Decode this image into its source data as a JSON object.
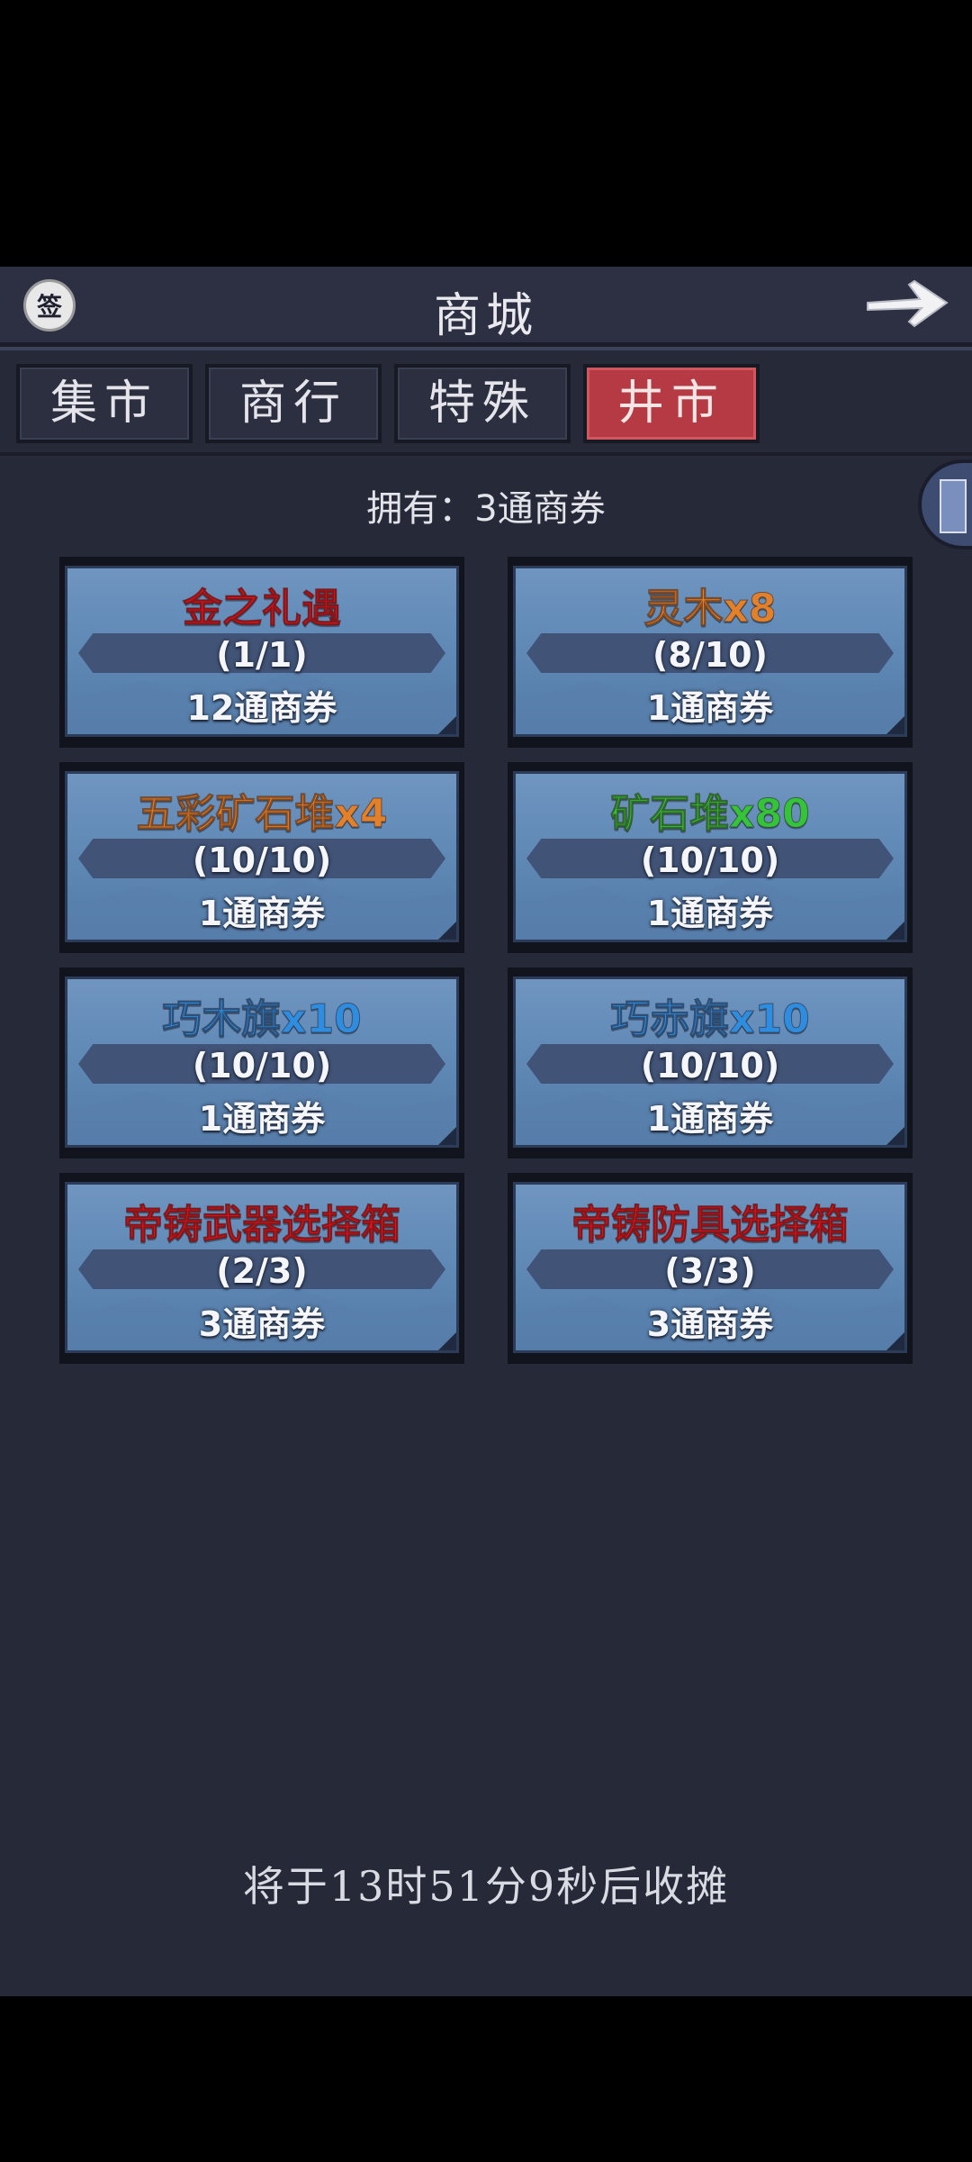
{
  "header": {
    "title": "商城",
    "seal_text": "签"
  },
  "tabs": [
    {
      "label": "集市",
      "active": false
    },
    {
      "label": "商行",
      "active": false
    },
    {
      "label": "特殊",
      "active": false
    },
    {
      "label": "井市",
      "active": true
    }
  ],
  "owned": "拥有：3通商券",
  "items": [
    {
      "name": "金之礼遇",
      "qty": "(1/1)",
      "price": "12通商券",
      "color": "#e8141b"
    },
    {
      "name": "灵木x8",
      "qty": "(8/10)",
      "price": "1通商券",
      "color": "#e3812a"
    },
    {
      "name": "五彩矿石堆x4",
      "qty": "(10/10)",
      "price": "1通商券",
      "color": "#e3812a"
    },
    {
      "name": "矿石堆x80",
      "qty": "(10/10)",
      "price": "1通商券",
      "color": "#35c33a"
    },
    {
      "name": "巧木旗x10",
      "qty": "(10/10)",
      "price": "1通商券",
      "color": "#2f8de0"
    },
    {
      "name": "巧赤旗x10",
      "qty": "(10/10)",
      "price": "1通商券",
      "color": "#2f8de0"
    },
    {
      "name": "帝铸武器选择箱",
      "qty": "(2/3)",
      "price": "3通商券",
      "color": "#e8141b"
    },
    {
      "name": "帝铸防具选择箱",
      "qty": "(3/3)",
      "price": "3通商券",
      "color": "#e8141b"
    }
  ],
  "footer": "将于13时51分9秒后收摊",
  "colors": {
    "panel_bg": "#262938",
    "active_tab": "#b63a43",
    "card_blue": "#6f95c0"
  }
}
